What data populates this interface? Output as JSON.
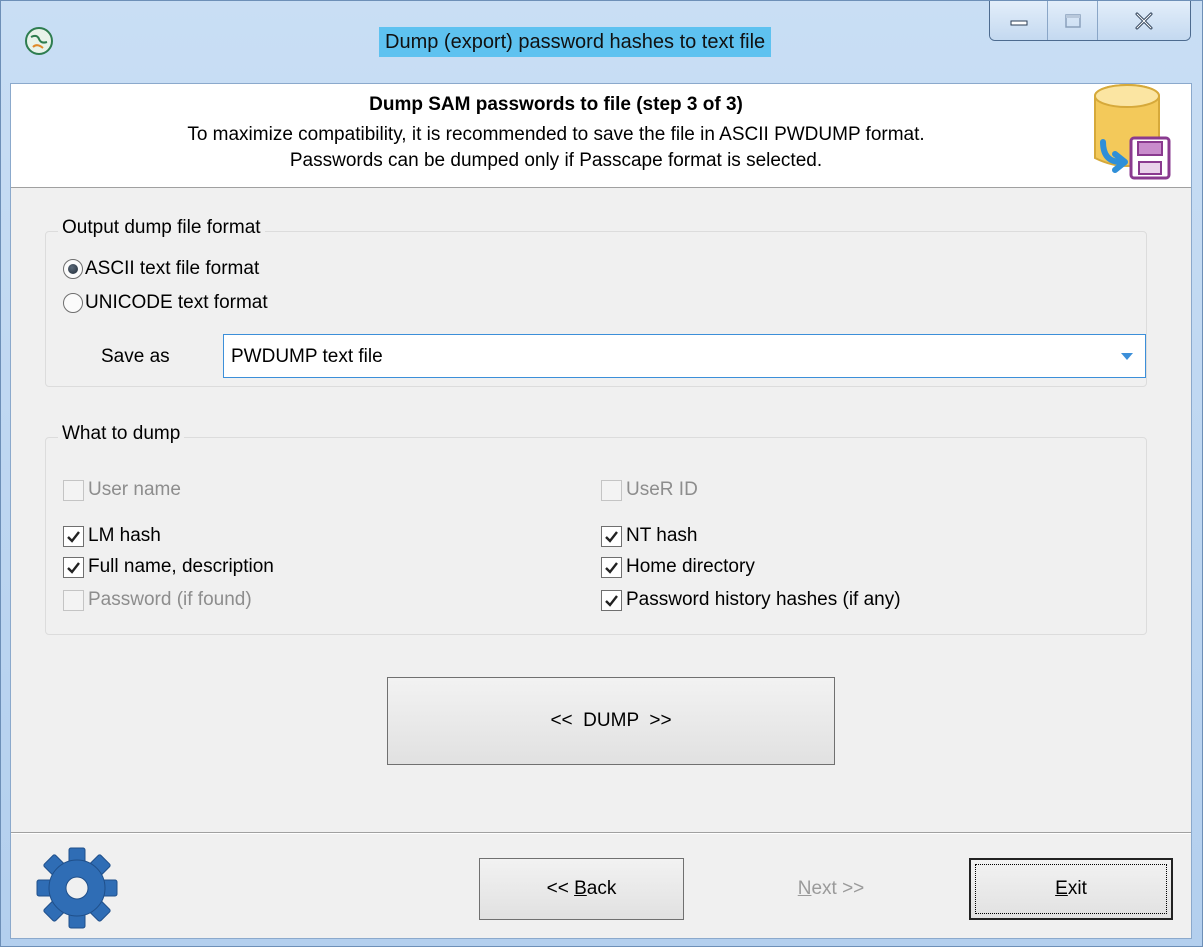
{
  "window": {
    "title": "Dump (export) password hashes to text file",
    "icon": "app-globe-icon",
    "controls": [
      "minimize-icon",
      "maximize-icon",
      "close-icon"
    ]
  },
  "header": {
    "title": "Dump SAM passwords to file (step 3 of 3)",
    "line1": "To maximize compatibility, it is recommended to save the file in ASCII PWDUMP format.",
    "line2": "Passwords can be dumped only if Passcape format is selected.",
    "icon": "database-save-icon"
  },
  "output_format": {
    "legend": "Output dump file format",
    "options": [
      {
        "label": "ASCII text file format",
        "selected": true
      },
      {
        "label": "UNICODE text format",
        "selected": false
      }
    ],
    "save_as_label": "Save as",
    "save_as_value": "PWDUMP text file"
  },
  "what_to_dump": {
    "legend": "What to dump",
    "left": [
      {
        "label": "User name",
        "checked": false,
        "enabled": false
      },
      {
        "label": "LM hash",
        "checked": true,
        "enabled": true
      },
      {
        "label": "Full name, description",
        "checked": true,
        "enabled": true
      },
      {
        "label": "Password (if found)",
        "checked": false,
        "enabled": false
      }
    ],
    "right": [
      {
        "label": "UseR ID",
        "checked": false,
        "enabled": false
      },
      {
        "label": "NT hash",
        "checked": true,
        "enabled": true
      },
      {
        "label": "Home directory",
        "checked": true,
        "enabled": true
      },
      {
        "label": "Password history hashes (if any)",
        "checked": true,
        "enabled": true
      }
    ]
  },
  "buttons": {
    "dump": "<<  DUMP  >>",
    "back_prefix": "<< ",
    "back_mnemonic": "B",
    "back_rest": "ack",
    "next_mnemonic": "N",
    "next_rest": "ext >>",
    "exit_mnemonic": "E",
    "exit_rest": "xit"
  },
  "footer": {
    "icon": "gear-icon"
  },
  "colors": {
    "accent": "#3c8fd9",
    "title_highlight": "#5ec2f0",
    "gear": "#2f6db5"
  }
}
